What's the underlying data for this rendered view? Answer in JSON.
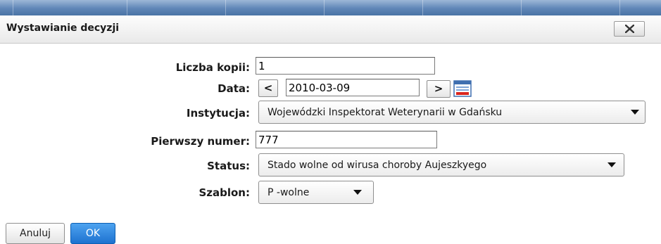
{
  "dialog": {
    "title": "Wystawianie decyzji",
    "close_icon": "close-x-icon"
  },
  "form": {
    "copies": {
      "label": "Liczba kopii:",
      "value": "1"
    },
    "date": {
      "label": "Data:",
      "value": "2010-03-09",
      "prev_label": "<",
      "next_label": ">",
      "calendar_icon": "calendar-icon"
    },
    "institution": {
      "label": "Instytucja:",
      "selected": "Wojewódzki Inspektorat Weterynarii w Gdańsku"
    },
    "first_number": {
      "label": "Pierwszy numer:",
      "value": "777"
    },
    "status": {
      "label": "Status:",
      "selected": "Stado wolne od wirusa choroby Aujeszkyego"
    },
    "template": {
      "label": "Szablon:",
      "selected": "P -wolne"
    }
  },
  "buttons": {
    "cancel": "Anuluj",
    "ok": "OK"
  },
  "colors": {
    "ok_button": "#1e72d0",
    "calendar_accent": "#d9251d"
  }
}
